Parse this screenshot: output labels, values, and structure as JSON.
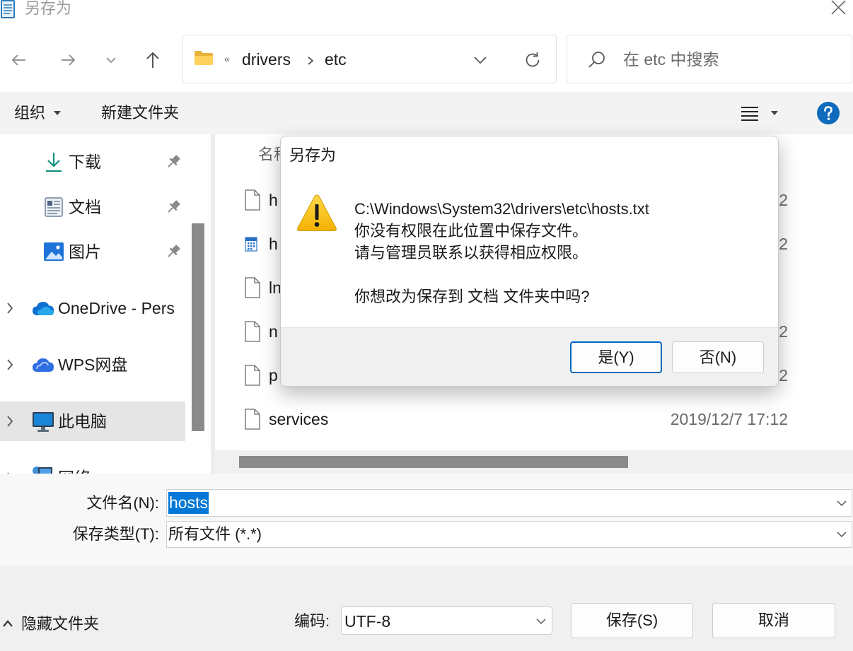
{
  "window": {
    "title": "另存为",
    "icon": "notepad-app-icon",
    "close_icon": "close-icon"
  },
  "navigation": {
    "back_icon": "arrow-left-icon",
    "forward_icon": "arrow-right-icon",
    "recent_icon": "chevron-down-icon",
    "up_icon": "arrow-up-icon"
  },
  "address_bar": {
    "icon": "folder-icon",
    "overflow": "«",
    "crumbs": [
      "drivers",
      "etc"
    ],
    "dropdown_icon": "chevron-down-icon",
    "refresh_icon": "refresh-icon"
  },
  "search": {
    "placeholder": "在 etc 中搜索",
    "icon": "search-icon"
  },
  "toolbar": {
    "organize_label": "组织",
    "new_folder_label": "新建文件夹",
    "view_icon": "list-view-icon",
    "help_icon": "help-icon"
  },
  "sidebar": {
    "items": [
      {
        "label": "下载",
        "icon": "download-icon",
        "pinned": true
      },
      {
        "label": "文档",
        "icon": "document-icon",
        "pinned": true
      },
      {
        "label": "图片",
        "icon": "pictures-icon",
        "pinned": true
      },
      {
        "label": "OneDrive - Pers",
        "icon": "onedrive-cloud-icon",
        "expandable": true
      },
      {
        "label": "WPS网盘",
        "icon": "wps-cloud-icon",
        "expandable": true
      },
      {
        "label": "此电脑",
        "icon": "computer-icon",
        "expandable": true,
        "selected": true
      },
      {
        "label": "网络",
        "icon": "network-icon",
        "expandable": true
      }
    ]
  },
  "file_list": {
    "columns": {
      "name": "名称"
    },
    "rows": [
      {
        "name": "h",
        "date": "2",
        "icon": "file-icon"
      },
      {
        "name": "h",
        "date": "2",
        "icon": "calendar-file-icon"
      },
      {
        "name": "ln",
        "date": "",
        "icon": "file-icon"
      },
      {
        "name": "n",
        "date": "2",
        "icon": "file-icon"
      },
      {
        "name": "p",
        "date": "2",
        "icon": "file-icon"
      },
      {
        "name": "services",
        "date": "2019/12/7 17:12",
        "icon": "file-icon"
      }
    ]
  },
  "dialog": {
    "title": "另存为",
    "icon": "warning-icon",
    "lines": [
      "C:\\Windows\\System32\\drivers\\etc\\hosts.txt",
      "你没有权限在此位置中保存文件。",
      "请与管理员联系以获得相应权限。",
      "你想改为保存到 文档 文件夹中吗?"
    ],
    "yes_label": "是(Y)",
    "no_label": "否(N)"
  },
  "save_form": {
    "filename_label": "文件名(N):",
    "filename_value": "hosts",
    "filetype_label": "保存类型(T):",
    "filetype_value": "所有文件 (*.*)",
    "hide_folders_label": "隐藏文件夹",
    "encoding_label": "编码:",
    "encoding_value": "UTF-8",
    "save_label": "保存(S)",
    "cancel_label": "取消"
  },
  "colors": {
    "accent": "#0f6cbd",
    "selection": "#0078d7",
    "default_button_border": "#0067c0",
    "warning": "#ffc61a",
    "folder": "#ffd15c",
    "download_icon": "#13907f"
  }
}
